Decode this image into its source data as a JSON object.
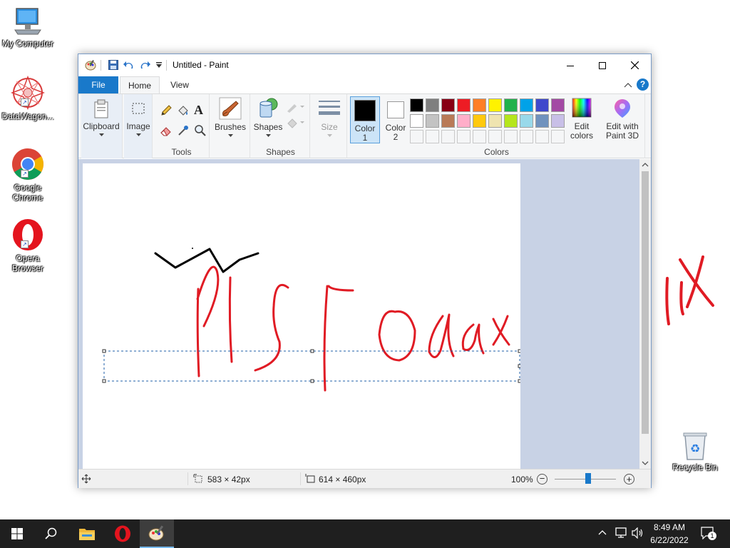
{
  "desktop": {
    "icons": [
      {
        "label": "My Computer"
      },
      {
        "label": "DataWagon..."
      },
      {
        "label": "Google Chrome"
      },
      {
        "label": "Opera Browser"
      },
      {
        "label": "Recycle Bin"
      }
    ]
  },
  "window": {
    "title": "Untitled - Paint",
    "tabs": [
      "File",
      "Home",
      "View"
    ],
    "ribbon": {
      "clipboard_label": "Clipboard",
      "image_label": "Image",
      "tools_group": "Tools",
      "brushes_label": "Brushes",
      "shapes_label": "Shapes",
      "shapes_group": "Shapes",
      "size_label": "Size",
      "color1_label": "Color 1",
      "color2_label": "Color 2",
      "colors_group": "Colors",
      "edit_colors_label": "Edit colors",
      "paint3d_label": "Edit with Paint 3D",
      "color1_value": "#000000",
      "color2_value": "#ffffff",
      "palette_row1": [
        "#000000",
        "#7f7f7f",
        "#880015",
        "#ed1c24",
        "#ff7f27",
        "#fff200",
        "#22b14c",
        "#00a2e8",
        "#3f48cc",
        "#a349a4"
      ],
      "palette_row2": [
        "#ffffff",
        "#c3c3c3",
        "#b97a57",
        "#ffaec9",
        "#ffc90e",
        "#efe4b0",
        "#b5e61d",
        "#99d9ea",
        "#7092be",
        "#c8bfe7"
      ]
    },
    "status": {
      "selection_size": "583 × 42px",
      "image_size": "614 × 460px",
      "zoom": "100%",
      "zoom_fraction": 0.55
    }
  },
  "taskbar": {
    "time": "8:49 AM",
    "date": "6/22/2022",
    "notification_count": "1"
  }
}
